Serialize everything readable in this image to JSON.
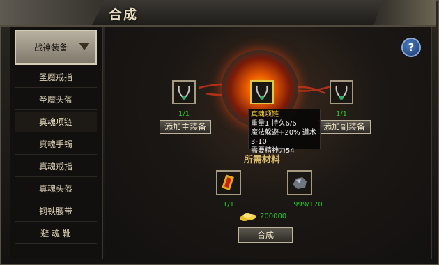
{
  "window": {
    "title": "合成"
  },
  "help_button": {
    "label": "?"
  },
  "sidebar": {
    "category": "战神装备",
    "items": [
      {
        "label": "圣魔戒指"
      },
      {
        "label": "圣魔头盔"
      },
      {
        "label": "真魂项链"
      },
      {
        "label": "真魂手镯"
      },
      {
        "label": "真魂戒指"
      },
      {
        "label": "真魂头盔"
      },
      {
        "label": "钢铁腰带"
      },
      {
        "label": "避 魂 靴"
      }
    ],
    "selected_index": 2
  },
  "main": {
    "left_slot": {
      "count": "1/1",
      "button_label": "添加主装备",
      "icon": "necklace-icon"
    },
    "right_slot": {
      "count": "1/1",
      "button_label": "添加副装备",
      "icon": "necklace-icon"
    },
    "result_slot": {
      "icon": "necklace-icon"
    },
    "materials_heading": "所需材料",
    "materials": [
      {
        "icon": "gold-scroll-icon",
        "count": "1/1"
      },
      {
        "icon": "ore-icon",
        "count": "999/170"
      }
    ],
    "gold_amount": "200000",
    "craft_button": "合成"
  },
  "tooltip": {
    "name": "真魂项链",
    "line1": "重量1  持久6/6",
    "line2": "魔法躲避+20%  道术3-10",
    "line3": "需要精神力54"
  }
}
